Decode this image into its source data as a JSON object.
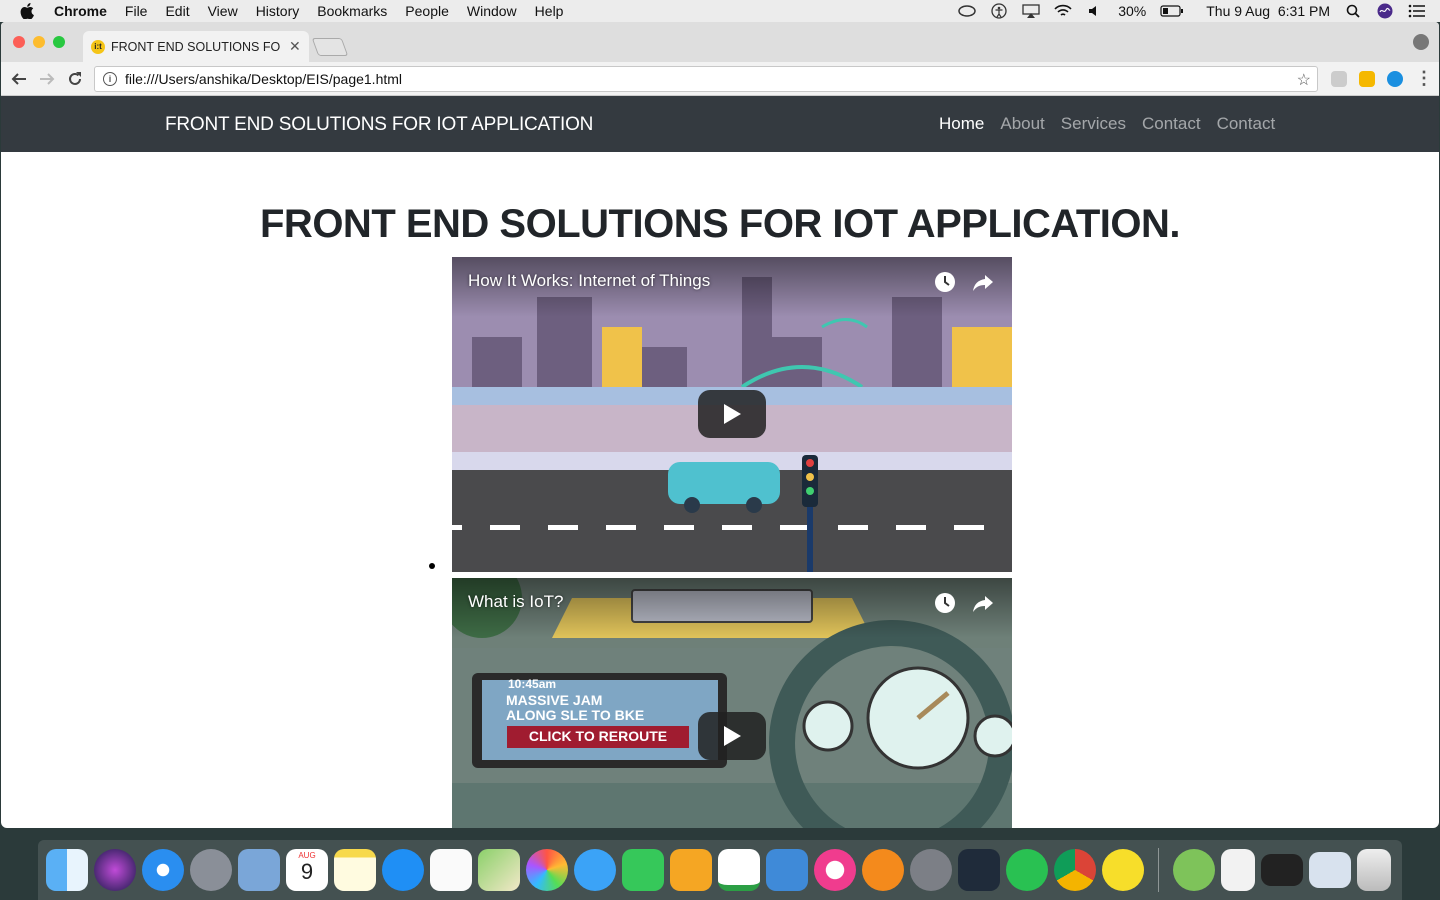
{
  "menubar": {
    "app": "Chrome",
    "items": [
      "File",
      "Edit",
      "View",
      "History",
      "Bookmarks",
      "People",
      "Window",
      "Help"
    ],
    "battery": "30%",
    "clock": "Thu 9 Aug  6:31 PM"
  },
  "browser": {
    "tab_title": "FRONT END SOLUTIONS FOR IOT APPLICATION",
    "url": "file:///Users/anshika/Desktop/EIS/page1.html",
    "favicon_text": "i:t"
  },
  "page": {
    "brand": "FRONT END SOLUTIONS FOR IOT APPLICATION",
    "nav": [
      "Home",
      "About",
      "Services",
      "Contact",
      "Contact"
    ],
    "headline": "FRONT END SOLUTIONS FOR IOT APPLICATION.",
    "videos": [
      {
        "title": "How It Works: Internet of Things"
      },
      {
        "title": "What is IoT?",
        "screen_line1": "10:45am",
        "screen_line2": "MASSIVE JAM",
        "screen_line3": "ALONG SLE TO BKE",
        "screen_button": "CLICK TO REROUTE"
      }
    ]
  },
  "dock": {
    "calendar_month": "AUG",
    "calendar_day": "9",
    "apps": [
      "finder-icon",
      "siri-icon",
      "safari-icon",
      "launchpad-icon",
      "preview-icon",
      "calendar-icon",
      "notes-icon",
      "app-store-icon",
      "reminders-icon",
      "maps-icon",
      "photos-icon",
      "messages-icon",
      "facetime-icon",
      "pages-icon",
      "numbers-icon",
      "keynote-icon",
      "itunes-icon",
      "ibooks-icon",
      "system-preferences-icon",
      "vscode-icon",
      "whatsapp-icon",
      "chrome-icon",
      "ok-icon",
      "android-studio-icon",
      "document-icon",
      "terminal-icon",
      "preview-window-icon",
      "trash-icon"
    ]
  }
}
